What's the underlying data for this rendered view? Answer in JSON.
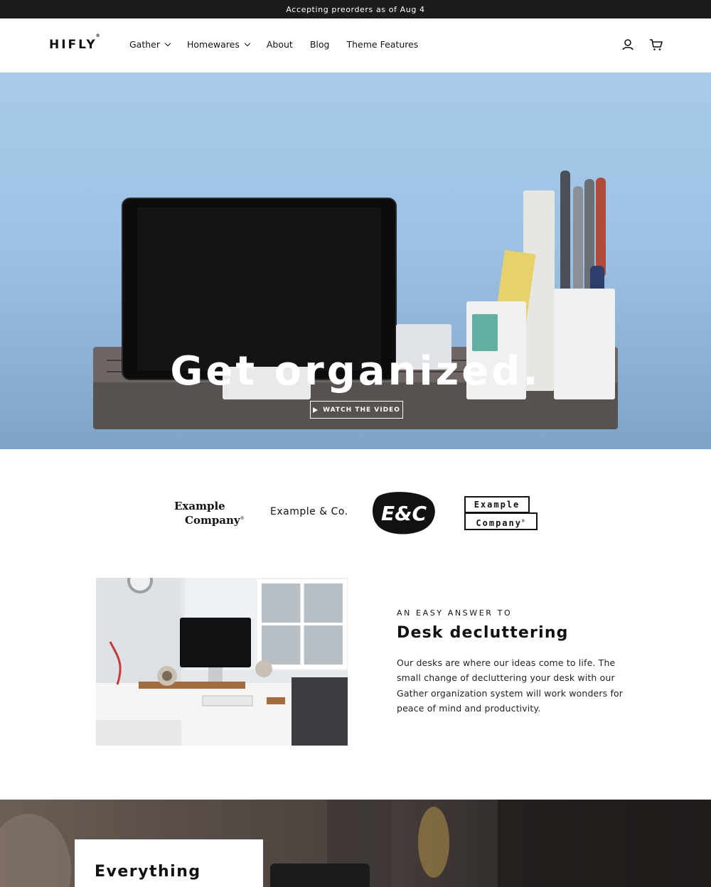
{
  "announcement": {
    "text": "Accepting preorders as of Aug 4"
  },
  "header": {
    "logo": "HIFLY",
    "logo_mark": "®",
    "nav": [
      {
        "label": "Gather",
        "has_dropdown": true
      },
      {
        "label": "Homewares",
        "has_dropdown": true
      },
      {
        "label": "About",
        "has_dropdown": false
      },
      {
        "label": "Blog",
        "has_dropdown": false
      },
      {
        "label": "Theme Features",
        "has_dropdown": false
      }
    ],
    "icons": [
      "account-icon",
      "cart-icon"
    ]
  },
  "hero": {
    "title": "Get organized.",
    "button_label": "WATCH THE VIDEO",
    "button_icon": "play-icon"
  },
  "logos": {
    "logo1_line1": "Example",
    "logo1_line2": "Company",
    "logo1_mark": "®",
    "logo2": "Example & Co.",
    "logo3": "E&C",
    "logo4_line1": "Example",
    "logo4_line2": "Company",
    "logo4_mark": "®"
  },
  "feature": {
    "eyebrow": "AN EASY ANSWER TO",
    "title": "Desk decluttering",
    "body": "Our desks are where our ideas come to life. The small change of decluttering your desk with our Gather organization system will work wonders for peace of mind and productivity."
  },
  "bottom": {
    "card_title": "Everything"
  },
  "colors": {
    "announcement_bg": "#1c1c1c",
    "hero_sky": "#a8cbe9",
    "text": "#111111"
  }
}
